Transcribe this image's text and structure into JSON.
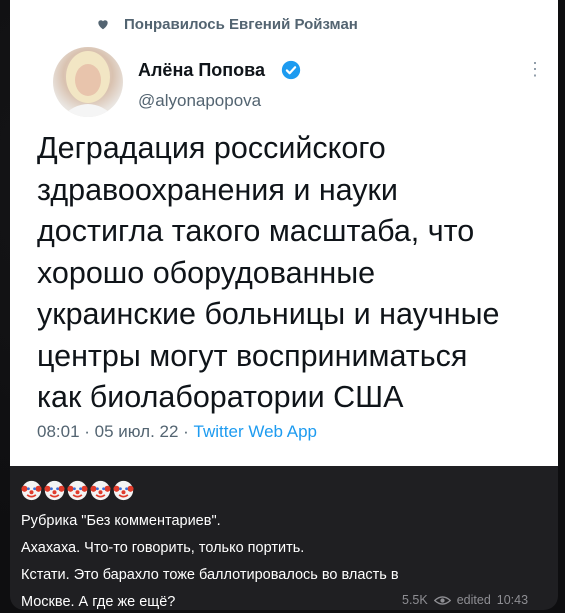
{
  "tweet": {
    "liked_by": "Понравилось Евгений Ройзман",
    "author_name": "Алёна Попова",
    "author_handle": "@alyonapopova",
    "text_lines": [
      "Деградация российского",
      "здравоохранения и науки",
      "достигла такого масштаба, что",
      "хорошо оборудованные",
      "украинские больницы и научные",
      "центры могут восприниматься",
      "как биолаборатории США"
    ],
    "time": "08:01",
    "date": "05 июл. 22",
    "separator": " · ",
    "source": "Twitter Web App"
  },
  "message": {
    "emoji_icons": [
      "clown-face-icon",
      "clown-face-icon",
      "clown-face-icon",
      "clown-face-icon",
      "clown-face-icon"
    ],
    "caption_lines": [
      "Рубрика \"Без комментариев\".",
      "Ахахаха. Что-то говорить, только портить.",
      "Кстати. Это барахло тоже баллотировалось во власть в",
      "Москве. А где же ещё?"
    ],
    "views": "5.5K",
    "edited_label": "edited",
    "time": "10:43"
  },
  "colors": {
    "verified": "#1d9bf0",
    "link": "#1d9bf0",
    "bubble": "#1f1f22"
  }
}
